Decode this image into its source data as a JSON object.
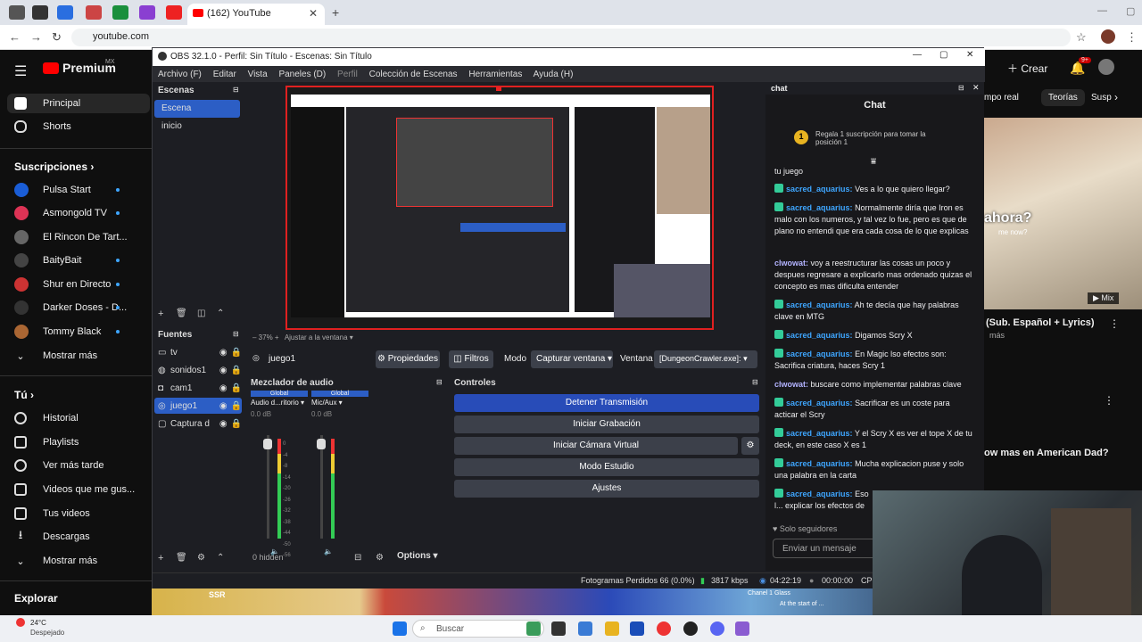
{
  "browser": {
    "active_tab_title": "(162) YouTube",
    "url": "youtube.com"
  },
  "youtube": {
    "logo_text": "Premium",
    "logo_region": "MX",
    "nav": [
      {
        "label": "Principal"
      },
      {
        "label": "Shorts"
      }
    ],
    "subs_title": "Suscripciones",
    "subs": [
      {
        "label": "Pulsa Start",
        "color": "#1a5dd6"
      },
      {
        "label": "Asmongold TV",
        "color": "#d35"
      },
      {
        "label": "El Rincon De Tart...",
        "color": "#666"
      },
      {
        "label": "BaityBait",
        "color": "#444"
      },
      {
        "label": "Shur en Directo",
        "color": "#c33"
      },
      {
        "label": "Darker Doses - D...",
        "color": "#333"
      },
      {
        "label": "Tommy Black",
        "color": "#a63"
      }
    ],
    "show_more": "Mostrar más",
    "you_title": "Tú",
    "you_items": [
      {
        "label": "Historial"
      },
      {
        "label": "Playlists"
      },
      {
        "label": "Ver más tarde"
      },
      {
        "label": "Videos que me gus..."
      },
      {
        "label": "Tus videos"
      },
      {
        "label": "Descargas"
      }
    ],
    "show_more2": "Mostrar más",
    "explore": "Explorar",
    "create": "Crear",
    "notif_count": "9+",
    "chips": [
      "mpo real",
      "Teorías",
      "Susp"
    ],
    "video_title1": "(Sub. Español + Lyrics)",
    "video_meta1": "más",
    "video_title2": "ow mas en American Dad?",
    "video_overlay": "ahora?",
    "video_overlay_sub": "me now?",
    "mix_label": "Mix"
  },
  "obs": {
    "title": "OBS 32.1.0 - Perfil: Sin Título - Escenas: Sin Título",
    "menu": [
      "Archivo (F)",
      "Editar",
      "Vista",
      "Paneles (D)",
      "Perfil",
      "Colección de Escenas",
      "Herramientas",
      "Ayuda (H)"
    ],
    "scenes_title": "Escenas",
    "scenes": [
      "Escena",
      "inicio"
    ],
    "sources_title": "Fuentes",
    "sources": [
      "tv",
      "sonidos1",
      "cam1",
      "juego1",
      "Captura d"
    ],
    "zoom": "37%",
    "fit_label": "Ajustar a la ventana",
    "source_bar": {
      "name": "juego1",
      "props": "Propiedades",
      "filters": "Filtros",
      "mode_label": "Modo",
      "mode_value": "Capturar ventana",
      "window_label": "Ventana",
      "window_value": "[DungeonCrawler.exe]:"
    },
    "mixer": {
      "title": "Mezclador de audio",
      "channels": [
        {
          "tag": "Global",
          "name": "Audio d...ritorio",
          "db": "0.0 dB"
        },
        {
          "tag": "Global",
          "name": "Mic/Aux",
          "db": "0.0 dB"
        }
      ],
      "scale": [
        "0",
        "-4",
        "-8",
        "-14",
        "-20",
        "-26",
        "-32",
        "-38",
        "-44",
        "-50",
        "-56",
        "-60"
      ]
    },
    "controls": {
      "title": "Controles",
      "buttons": [
        "Detener Transmisión",
        "Iniciar Grabación",
        "Iniciar Cámara Virtual",
        "Modo Estudio",
        "Ajustes"
      ]
    },
    "hidden_label": "0 hidden",
    "options_label": "Options",
    "status": {
      "dropped": "Fotogramas Perdidos 66 (0.0%)",
      "bitrate": "3817 kbps",
      "live_time": "04:22:19",
      "rec_time": "00:00:00",
      "cpu": "CPU"
    }
  },
  "chat": {
    "panel_title": "chat",
    "header": "Chat",
    "pinned": "Regala 1 suscripción para tomar la posición 1",
    "pinned_rank": "1",
    "messages": [
      {
        "user": "",
        "text": "tu juego"
      },
      {
        "user": "sacred_aquarius:",
        "text": "Ves a lo que quiero llegar?"
      },
      {
        "user": "sacred_aquarius:",
        "text": "Normalmente diría que Iron es malo con los numeros, y tal vez lo fue, pero es que de plano no entendi que era cada cosa de lo que explicas"
      },
      {
        "user": "clwowat:",
        "text": "voy a reestructurar las cosas un poco y despues regresare a explicarlo mas ordenado quizas el concepto es mas dificulta entender"
      },
      {
        "user": "sacred_aquarius:",
        "text": "Ah te decía que hay palabras clave en MTG"
      },
      {
        "user": "sacred_aquarius:",
        "text": "Digamos Scry X"
      },
      {
        "user": "sacred_aquarius:",
        "text": "En Magic lso efectos son: Sacrifica criatura, haces Scry 1"
      },
      {
        "user": "clwowat:",
        "text": "buscare como implementar palabras clave"
      },
      {
        "user": "sacred_aquarius:",
        "text": "Sacrificar es un coste para acticar el Scry"
      },
      {
        "user": "sacred_aquarius:",
        "text": "Y el Scry X es ver el tope X de tu deck, en este caso X es 1"
      },
      {
        "user": "sacred_aquarius:",
        "text": "Mucha explicacion puse y solo una palabra en la carta"
      },
      {
        "user": "sacred_aquarius:",
        "text": "Eso l... explicar los efectos de lo q..."
      }
    ],
    "followers_only": "Solo seguidores",
    "input_placeholder": "Enviar un mensaje"
  },
  "taskbar": {
    "weather_temp": "24°C",
    "weather_desc": "Despejado",
    "search_placeholder": "Buscar"
  },
  "game_strip": {
    "chip1": "SSR",
    "chip2": "Chanel 1 Glass",
    "chip3": "At the start of ..."
  }
}
